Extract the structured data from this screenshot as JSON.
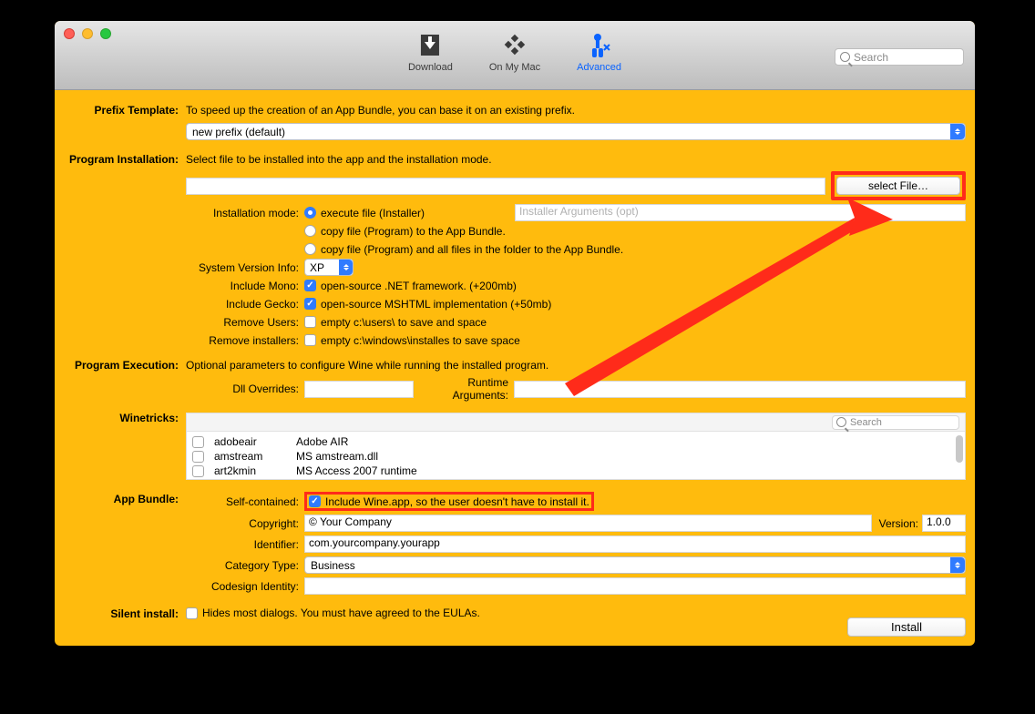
{
  "tabs": {
    "download": "Download",
    "onmymac": "On My Mac",
    "advanced": "Advanced"
  },
  "toolbar_search_ph": "Search",
  "prefix": {
    "label": "Prefix Template:",
    "desc": "To speed up the creation of an App Bundle, you can base it on an existing prefix.",
    "selected": "new prefix (default)"
  },
  "program_install": {
    "label": "Program Installation:",
    "desc": "Select file to be installed into the app and the installation mode.",
    "file_value": "",
    "select_file_btn": "select File…",
    "install_mode_label": "Installation mode:",
    "radio1": "execute file (Installer)",
    "radio2": "copy file (Program)  to the App Bundle.",
    "radio3": "copy file (Program)  and all files in the folder to the App Bundle.",
    "args_ph": "Installer Arguments (opt)",
    "sysver_label": "System Version Info:",
    "sysver_value": "XP",
    "mono_label": "Include Mono:",
    "mono_text": "open-source .NET framework. (+200mb)",
    "gecko_label": "Include Gecko:",
    "gecko_text": "open-source MSHTML implementation (+50mb)",
    "remove_users_label": "Remove Users:",
    "remove_users_text": "empty c:\\users\\ to save and space",
    "remove_installers_label": "Remove installers:",
    "remove_installers_text": "empty c:\\windows\\installes to save space"
  },
  "program_exec": {
    "label": "Program Execution:",
    "desc": "Optional parameters to configure Wine while running the installed program.",
    "dll_label": "Dll Overrides:",
    "dll_value": "",
    "runtime_label": "Runtime Arguments:",
    "runtime_value": ""
  },
  "winetricks": {
    "label": "Winetricks:",
    "search_ph": "Search",
    "rows": [
      {
        "key": "adobeair",
        "desc": "Adobe AIR"
      },
      {
        "key": "amstream",
        "desc": "MS amstream.dll"
      },
      {
        "key": "art2kmin",
        "desc": "MS Access 2007 runtime"
      }
    ]
  },
  "appbundle": {
    "label": "App Bundle:",
    "selfcontained_label": "Self-contained:",
    "selfcontained_text": "Include Wine.app, so the user doesn't have to install it.",
    "copyright_label": "Copyright:",
    "copyright_value": "© Your Company",
    "version_label": "Version:",
    "version_value": "1.0.0",
    "identifier_label": "Identifier:",
    "identifier_value": "com.yourcompany.yourapp",
    "category_label": "Category Type:",
    "category_value": "Business",
    "codesign_label": "Codesign Identity:",
    "codesign_value": ""
  },
  "silent": {
    "label": "Silent install:",
    "text": "Hides most dialogs. You must have agreed to the EULAs."
  },
  "install_btn": "Install"
}
